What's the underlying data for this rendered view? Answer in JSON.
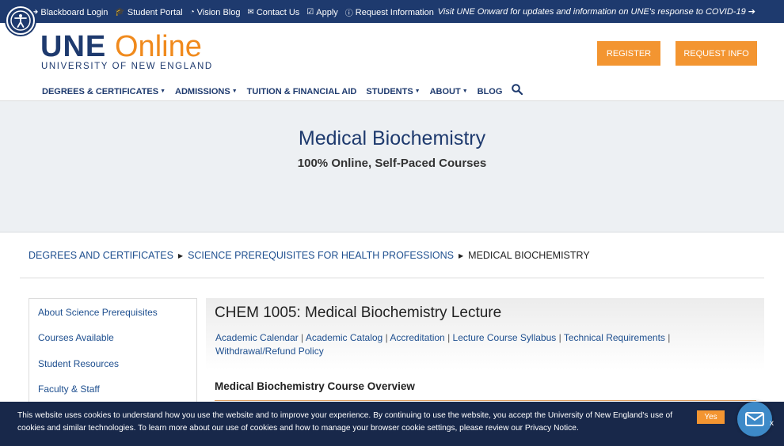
{
  "utility_bar": {
    "links": [
      {
        "icon": "sign-in-icon",
        "glyph": "➔",
        "label": "Blackboard Login"
      },
      {
        "icon": "graduation-cap-icon",
        "glyph": "🎓",
        "label": "Student Portal"
      },
      {
        "icon": "rss-icon",
        "glyph": "◔",
        "label": "Vision Blog"
      },
      {
        "icon": "envelope-icon",
        "glyph": "✉",
        "label": "Contact Us"
      },
      {
        "icon": "check-square-icon",
        "glyph": "☑",
        "label": "Apply"
      },
      {
        "icon": "info-circle-icon",
        "glyph": "ⓘ",
        "label": "Request Information"
      }
    ],
    "covid_notice": "Visit UNE Onward for updates and information on UNE's response to COVID-19"
  },
  "logo": {
    "main": "UNE",
    "online": "Online",
    "subtitle": "UNIVERSITY OF NEW ENGLAND"
  },
  "header_buttons": {
    "register": "REGISTER",
    "request_info": "REQUEST INFO"
  },
  "main_nav": [
    {
      "label": "DEGREES & CERTIFICATES",
      "dropdown": true
    },
    {
      "label": "ADMISSIONS",
      "dropdown": true
    },
    {
      "label": "TUITION & FINANCIAL AID",
      "dropdown": false
    },
    {
      "label": "STUDENTS",
      "dropdown": true
    },
    {
      "label": "ABOUT",
      "dropdown": true
    },
    {
      "label": "BLOG",
      "dropdown": false
    }
  ],
  "hero": {
    "title": "Medical Biochemistry",
    "subtitle": "100% Online, Self-Paced Courses"
  },
  "breadcrumb": {
    "items": [
      "DEGREES AND CERTIFICATES",
      "SCIENCE PREREQUISITES FOR HEALTH PROFESSIONS"
    ],
    "current": "MEDICAL BIOCHEMISTRY"
  },
  "sidebar": {
    "items": [
      "About Science Prerequisites",
      "Courses Available",
      "Student Resources",
      "Faculty & Staff"
    ]
  },
  "content": {
    "course_title": "CHEM 1005: Medical Biochemistry Lecture",
    "links": [
      "Academic Calendar",
      "Academic Catalog",
      "Accreditation",
      "Lecture Course Syllabus",
      "Technical Requirements",
      "Withdrawal/Refund Policy"
    ],
    "link_separator": " | ",
    "overview_title": "Medical Biochemistry Course Overview"
  },
  "cookie_bar": {
    "text": "This website uses cookies to understand how you use the website and to improve your experience. By continuing to use the website, you accept the University of New England's use of cookies and similar technologies. To learn more about our use of cookies and how to manage your browser cookie settings, please review our Privacy Notice.",
    "accept_label": "Yes",
    "close_label": "x"
  },
  "colors": {
    "navy": "#1e3a6e",
    "orange": "#f39531",
    "hero_bg": "#edf0f3",
    "cookie_bg": "#18284a",
    "link": "#1e4f8f"
  }
}
